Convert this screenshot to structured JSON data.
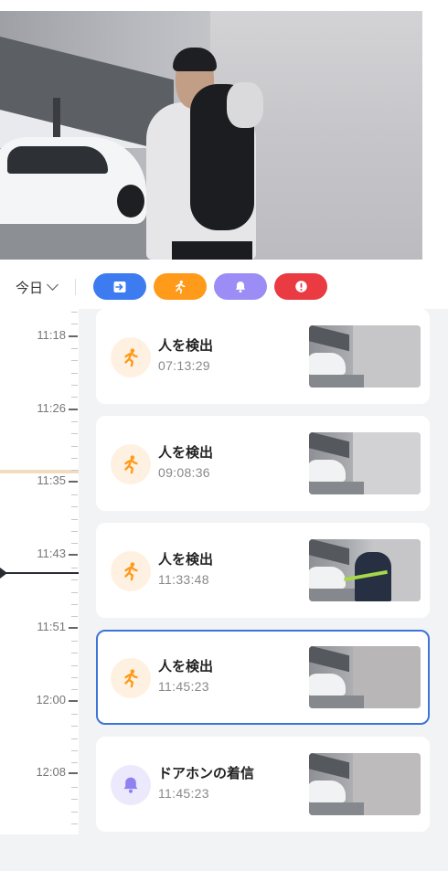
{
  "filters": {
    "day_label": "今日",
    "chips": [
      {
        "name": "filter-all-button",
        "icon": "arrow-right-icon",
        "color": "#3d7bf0"
      },
      {
        "name": "filter-person-button",
        "icon": "running-person-icon",
        "color": "#ff9a1a"
      },
      {
        "name": "filter-doorbell-button",
        "icon": "bell-icon",
        "color": "#9b8df5"
      },
      {
        "name": "filter-alert-button",
        "icon": "exclamation-icon",
        "color": "#ea3b43"
      }
    ]
  },
  "timeline": {
    "labels": [
      "11:18",
      "11:26",
      "11:35",
      "11:43",
      "11:51",
      "12:00",
      "12:08"
    ]
  },
  "events": [
    {
      "title": "人を検出",
      "time": "07:13:29",
      "icon": "running-person-icon",
      "thumbnail_has_person": false
    },
    {
      "title": "人を検出",
      "time": "09:08:36",
      "icon": "running-person-icon",
      "thumbnail_has_person": false
    },
    {
      "title": "人を検出",
      "time": "11:33:48",
      "icon": "running-person-icon",
      "thumbnail_has_person": true
    },
    {
      "title": "人を検出",
      "time": "11:45:23",
      "icon": "running-person-icon",
      "thumbnail_has_person": false,
      "selected": true
    },
    {
      "title": "ドアホンの着信",
      "time": "11:45:23",
      "icon": "bell-icon",
      "thumbnail_has_person": false
    }
  ],
  "colors": {
    "accent_orange": "#ff9a1a",
    "accent_purple": "#8f82f0",
    "selected_border": "#3d74d7"
  }
}
